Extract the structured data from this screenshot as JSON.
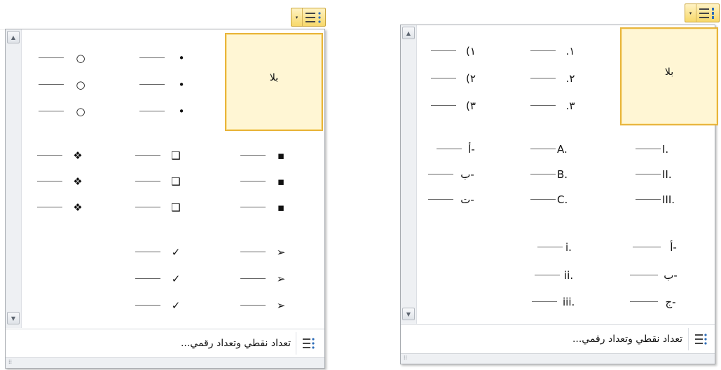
{
  "left_panel": {
    "none_label": "بلا",
    "bullet_rows": [
      {
        "top": [
          "○",
          "•"
        ],
        "mid": [
          "❖",
          "❑",
          "▪"
        ],
        "bot": [
          "",
          "✓",
          "➢"
        ]
      }
    ],
    "col_a": [
      "○",
      "○",
      "○"
    ],
    "col_b": [
      "•",
      "•",
      "•"
    ],
    "set2_a": [
      "❖",
      "❖",
      "❖"
    ],
    "set2_b": [
      "❑",
      "❑",
      "❑"
    ],
    "set2_c": [
      "▪",
      "▪",
      "▪"
    ],
    "set3_b": [
      "✓",
      "✓",
      "✓"
    ],
    "set3_c": [
      "➢",
      "➢",
      "➢"
    ],
    "footer_text": "تعداد نقطي وتعداد رقمي..."
  },
  "right_panel": {
    "none_label": "بلا",
    "set1_a": [
      "(١",
      "(٢",
      "(٣"
    ],
    "set1_b": [
      ".١",
      ".٢",
      ".٣"
    ],
    "set2_a": [
      "أ-",
      "ب-",
      "ت-"
    ],
    "set2_b": [
      "A.",
      "B.",
      "C."
    ],
    "set2_c": [
      "I.",
      "II.",
      "III."
    ],
    "set3_b": [
      "i.",
      "ii.",
      "iii."
    ],
    "set3_c": [
      "أ-",
      "ب-",
      "ج-"
    ],
    "footer_text": "تعداد نقطي وتعداد رقمي..."
  },
  "icons": {
    "scroll_up": "▲",
    "scroll_down": "▼",
    "dropdown": "▾",
    "grip": "⁞⁞"
  }
}
